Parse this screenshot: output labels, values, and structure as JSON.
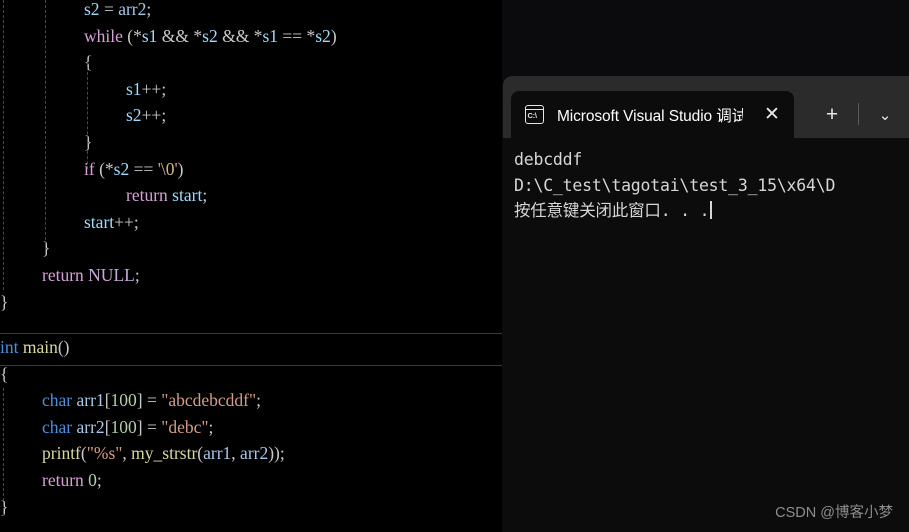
{
  "editor": {
    "language": "c",
    "background": "#000000",
    "upper_block": [
      {
        "indent": 84,
        "tokens": [
          {
            "t": "s2",
            "c": "ident"
          },
          {
            "t": " = ",
            "c": "op"
          },
          {
            "t": "arr2",
            "c": "var"
          },
          {
            "t": ";",
            "c": "punc"
          }
        ]
      },
      {
        "indent": 84,
        "tokens": [
          {
            "t": "while",
            "c": "kw"
          },
          {
            "t": " (",
            "c": "punc"
          },
          {
            "t": "*",
            "c": "op"
          },
          {
            "t": "s1",
            "c": "ident"
          },
          {
            "t": " && ",
            "c": "op"
          },
          {
            "t": "*",
            "c": "op"
          },
          {
            "t": "s2",
            "c": "ident"
          },
          {
            "t": " && ",
            "c": "op"
          },
          {
            "t": "*",
            "c": "op"
          },
          {
            "t": "s1",
            "c": "ident"
          },
          {
            "t": " == ",
            "c": "op"
          },
          {
            "t": "*",
            "c": "op"
          },
          {
            "t": "s2",
            "c": "ident"
          },
          {
            "t": ")",
            "c": "punc"
          }
        ]
      },
      {
        "indent": 84,
        "tokens": [
          {
            "t": "{",
            "c": "punc"
          }
        ]
      },
      {
        "indent": 126,
        "tokens": [
          {
            "t": "s1",
            "c": "ident"
          },
          {
            "t": "++",
            "c": "op"
          },
          {
            "t": ";",
            "c": "punc"
          }
        ]
      },
      {
        "indent": 126,
        "tokens": [
          {
            "t": "s2",
            "c": "ident"
          },
          {
            "t": "++",
            "c": "op"
          },
          {
            "t": ";",
            "c": "punc"
          }
        ]
      },
      {
        "indent": 84,
        "tokens": [
          {
            "t": "}",
            "c": "punc"
          }
        ]
      },
      {
        "indent": 84,
        "tokens": [
          {
            "t": "if",
            "c": "kw"
          },
          {
            "t": " (",
            "c": "punc"
          },
          {
            "t": "*",
            "c": "op"
          },
          {
            "t": "s2",
            "c": "ident"
          },
          {
            "t": " == ",
            "c": "op"
          },
          {
            "t": "'",
            "c": "str"
          },
          {
            "t": "\\0",
            "c": "esc"
          },
          {
            "t": "'",
            "c": "str"
          },
          {
            "t": ")",
            "c": "punc"
          }
        ]
      },
      {
        "indent": 126,
        "tokens": [
          {
            "t": "return",
            "c": "kw"
          },
          {
            "t": " ",
            "c": "op"
          },
          {
            "t": "start",
            "c": "ident"
          },
          {
            "t": ";",
            "c": "punc"
          }
        ]
      },
      {
        "indent": 84,
        "tokens": [
          {
            "t": "start",
            "c": "ident"
          },
          {
            "t": "++",
            "c": "op"
          },
          {
            "t": ";",
            "c": "punc"
          }
        ]
      },
      {
        "indent": 42,
        "tokens": [
          {
            "t": "}",
            "c": "punc"
          }
        ]
      },
      {
        "indent": 42,
        "tokens": [
          {
            "t": "return",
            "c": "kw"
          },
          {
            "t": " ",
            "c": "op"
          },
          {
            "t": "NULL",
            "c": "mac"
          },
          {
            "t": ";",
            "c": "punc"
          }
        ]
      },
      {
        "indent": 0,
        "tokens": [
          {
            "t": "}",
            "c": "punc"
          }
        ]
      }
    ],
    "lower_block": [
      {
        "indent": 0,
        "highlight": true,
        "tokens": [
          {
            "t": "int",
            "c": "type"
          },
          {
            "t": " ",
            "c": "op"
          },
          {
            "t": "main",
            "c": "fn"
          },
          {
            "t": "()",
            "c": "punc"
          }
        ]
      },
      {
        "indent": 0,
        "tokens": [
          {
            "t": "{",
            "c": "punc"
          }
        ]
      },
      {
        "indent": 42,
        "tokens": [
          {
            "t": "char",
            "c": "type"
          },
          {
            "t": " ",
            "c": "op"
          },
          {
            "t": "arr1",
            "c": "var"
          },
          {
            "t": "[",
            "c": "punc"
          },
          {
            "t": "100",
            "c": "num"
          },
          {
            "t": "]",
            "c": "punc"
          },
          {
            "t": " = ",
            "c": "op"
          },
          {
            "t": "\"abcdebcddf\"",
            "c": "str"
          },
          {
            "t": ";",
            "c": "punc"
          }
        ]
      },
      {
        "indent": 42,
        "tokens": [
          {
            "t": "char",
            "c": "type"
          },
          {
            "t": " ",
            "c": "op"
          },
          {
            "t": "arr2",
            "c": "var"
          },
          {
            "t": "[",
            "c": "punc"
          },
          {
            "t": "100",
            "c": "num"
          },
          {
            "t": "]",
            "c": "punc"
          },
          {
            "t": " = ",
            "c": "op"
          },
          {
            "t": "\"debc\"",
            "c": "str"
          },
          {
            "t": ";",
            "c": "punc"
          }
        ]
      },
      {
        "indent": 42,
        "tokens": [
          {
            "t": "printf",
            "c": "fn"
          },
          {
            "t": "(",
            "c": "punc"
          },
          {
            "t": "\"%s\"",
            "c": "str"
          },
          {
            "t": ", ",
            "c": "punc"
          },
          {
            "t": "my_strstr",
            "c": "fn"
          },
          {
            "t": "(",
            "c": "punc"
          },
          {
            "t": "arr1",
            "c": "var"
          },
          {
            "t": ", ",
            "c": "punc"
          },
          {
            "t": "arr2",
            "c": "var"
          },
          {
            "t": "))",
            "c": "punc"
          },
          {
            "t": ";",
            "c": "punc"
          }
        ]
      },
      {
        "indent": 42,
        "tokens": [
          {
            "t": "return",
            "c": "kw"
          },
          {
            "t": " ",
            "c": "op"
          },
          {
            "t": "0",
            "c": "num"
          },
          {
            "t": ";",
            "c": "punc"
          }
        ]
      },
      {
        "indent": 0,
        "tokens": [
          {
            "t": "}",
            "c": "punc"
          }
        ]
      }
    ],
    "plain_text_upper": "        s2 = arr2;\n        while (*s1 && *s2 && *s1 == *s2)\n        {\n            s1++;\n            s2++;\n        }\n        if (*s2 == '\\0')\n            return start;\n        start++;\n    }\n    return NULL;\n}",
    "plain_text_lower": "int main()\n{\n    char arr1[100] = \"abcdebcddf\";\n    char arr2[100] = \"debc\";\n    printf(\"%s\", my_strstr(arr1, arr2));\n    return 0;\n}"
  },
  "terminal": {
    "tab": {
      "title": "Microsoft Visual Studio 调试控",
      "icon": "command-prompt-icon",
      "close_label": "✕"
    },
    "new_tab_label": "+",
    "dropdown_label": "⌄",
    "lines": [
      "debcddf",
      "D:\\C_test\\tagotai\\test_3_15\\x64\\D",
      "按任意键关闭此窗口. . ."
    ],
    "colors": {
      "tabbar_background": "#2b2b2b",
      "body_background": "#0c0c0c",
      "text": "#d6d6d6"
    }
  },
  "watermark": {
    "text": "CSDN @博客小梦"
  }
}
